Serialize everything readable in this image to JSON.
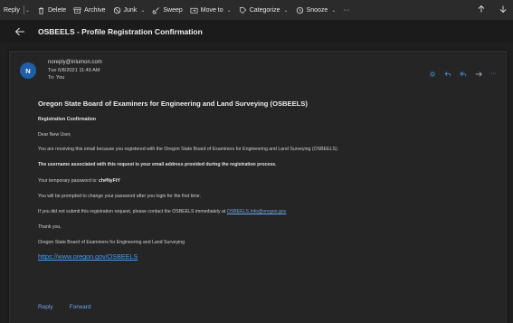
{
  "toolbar": {
    "reply": "Reply",
    "delete": "Delete",
    "archive": "Archive",
    "junk": "Junk",
    "sweep": "Sweep",
    "move_to": "Move to",
    "categorize": "Categorize",
    "snooze": "Snooze",
    "more": "···"
  },
  "subject": "OSBEELS - Profile Registration Confirmation",
  "message": {
    "avatar_initial": "N",
    "from": "noreply@inlumon.com",
    "date": "Tue 6/8/2021 11:49 AM",
    "to": "To: You"
  },
  "email": {
    "heading": "Oregon State Board of Examiners for Engineering and Land Surveying (OSBEELS)",
    "section": "Registration Confirmation",
    "greeting": "Dear New User,",
    "p1": "You are receiving this email because you registered with the Oregon State Board of Examiners for Engineering and Land Surveying (OSBEELS).",
    "p2": "The username associated with this request is your email address provided during the registration process.",
    "p3_prefix": "Your temporary password is:",
    "p3_password": "ch#NyFtY",
    "p4": "You will be prompted to change your password after you login for the first time.",
    "p5_prefix": "If you did not submit this registration request, please contact the OSBEELS immediately at",
    "p5_email": "OSBEELS.Info@oregon.gov",
    "thanks": "Thank you,",
    "signature": "Oregon State Board of Examiners for Engineering and Land Surveying",
    "website": "https://www.oregon.gov/OSBEELS"
  },
  "footer": {
    "reply": "Reply",
    "forward": "Forward"
  },
  "colors": {
    "accent": "#4f9ae8",
    "avatar": "#1e5fa8",
    "background": "#1f1f1f"
  }
}
